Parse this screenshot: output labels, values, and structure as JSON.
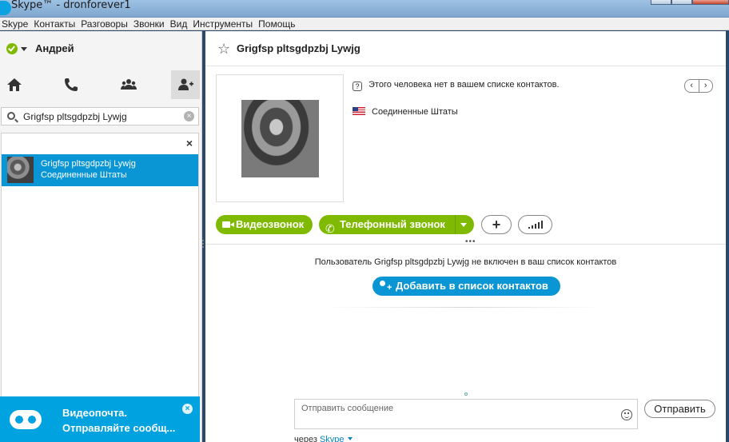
{
  "window": {
    "title": "Skype™ - dronforever1"
  },
  "menu": [
    "Skype",
    "Контакты",
    "Разговоры",
    "Звонки",
    "Вид",
    "Инструменты",
    "Помощь"
  ],
  "user": {
    "name": "Андрей",
    "status": "online",
    "status_color": "#7fba00"
  },
  "nav": [
    {
      "name": "home-icon",
      "active": false
    },
    {
      "name": "phone-icon",
      "active": false
    },
    {
      "name": "group-icon",
      "active": false
    },
    {
      "name": "add-contact-icon",
      "active": true
    }
  ],
  "search": {
    "value": "Grigfsp pltsgdpzbj Lywjg"
  },
  "results": [
    {
      "name": "Grigfsp pltsgdpzbj Lywjg",
      "location": "Соединенные Штаты"
    }
  ],
  "voicemail": {
    "title": "Видеопочта.",
    "subtitle": "Отправляйте сообщ..."
  },
  "contact": {
    "title": "Grigfsp pltsgdpzbj Lywjg",
    "not_in_list": "Этого человека нет в вашем списке контактов.",
    "country": "Соединенные Штаты"
  },
  "actions": {
    "video_call": "Видеозвонок",
    "phone_call": "Телефонный звонок",
    "accent_color": "#7fba00"
  },
  "notice": {
    "text": "Пользователь Grigfsp pltsgdpzbj Lywjg не включен в ваш список контактов",
    "add_button": "Добавить в список контактов",
    "button_color": "#0a95d4"
  },
  "composer": {
    "placeholder": "Отправить сообщение",
    "send_label": "Отправить",
    "via_prefix": "через",
    "via_service": "Skype"
  }
}
